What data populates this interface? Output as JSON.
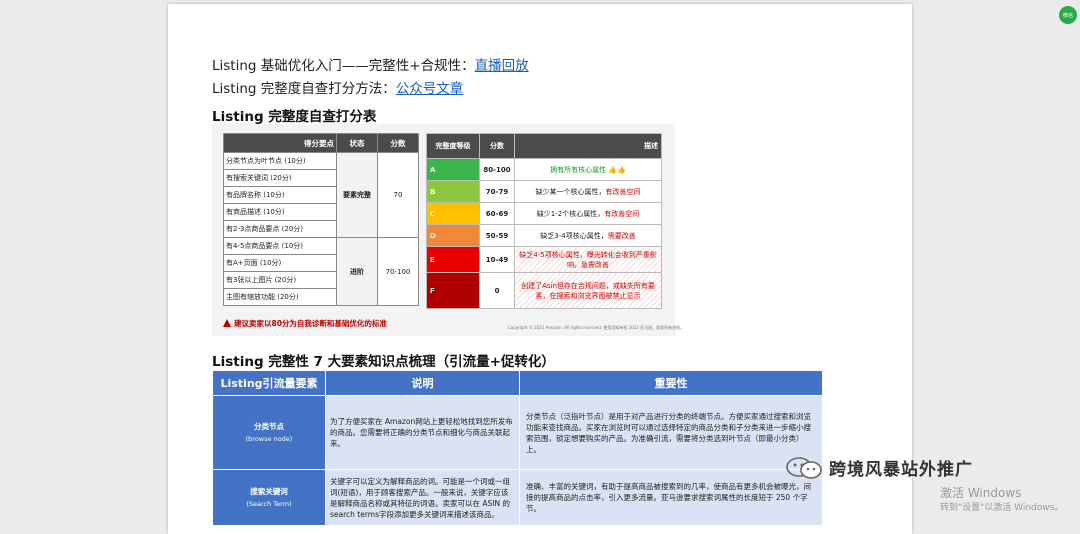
{
  "intro": {
    "line1_prefix": "Listing 基础优化入门——完整性+合规性：",
    "line1_link": "直播回放",
    "line2_prefix": "Listing 完整度自查打分方法：",
    "line2_link": "公众号文章"
  },
  "section1_title": "Listing 完整度自查打分表",
  "score_table": {
    "headers": [
      "得分要点",
      "状态",
      "分数"
    ],
    "groups": [
      {
        "state": "要素完整",
        "points": "70",
        "items": [
          "分类节点为叶节点 (10分)",
          "有搜索关键词 (20分)",
          "有品牌名称 (10分)",
          "有商品描述 (10分)",
          "有2-3点商品要点 (20分)"
        ]
      },
      {
        "state": "进阶",
        "points": "70-100",
        "items": [
          "有4-5点商品要点 (10分)",
          "有A+页面 (10分)",
          "有3张以上图片 (20分)",
          "主图有缩放功能 (20分)"
        ]
      }
    ],
    "warning": "建议卖家以80分为自我诊断和基础优化的标准"
  },
  "level_table": {
    "headers": [
      "完整度等级",
      "分数",
      "描述"
    ],
    "rows": [
      {
        "level": "A",
        "score": "80-100",
        "desc_plain": "",
        "desc_red": "",
        "desc_green": "拥有所有核心属性 👍👍",
        "color": "#3ab54a"
      },
      {
        "level": "B",
        "score": "70-79",
        "desc_plain": "缺少某一个核心属性，",
        "desc_red": "有改善空间",
        "desc_green": "",
        "color": "#8dc63f"
      },
      {
        "level": "C",
        "score": "60-69",
        "desc_plain": "缺少1-2个核心属性，",
        "desc_red": "有改善空间",
        "desc_green": "",
        "color": "#ffc000"
      },
      {
        "level": "D",
        "score": "50-59",
        "desc_plain": "缺乏3-4项核心属性，",
        "desc_red": "需要改善",
        "desc_green": "",
        "color": "#f0883a"
      },
      {
        "level": "E",
        "score": "10-49",
        "desc_plain": "",
        "desc_red": "缺乏4-5项核心属性，曝光转化会收到严重影响，急需改善",
        "desc_green": "",
        "color": "#e60000"
      },
      {
        "level": "F",
        "score": "0",
        "desc_plain": "",
        "desc_red": "创建了Asin但存在合规问题，或缺失所有要素，在搜索和浏览界面被禁止显示",
        "desc_green": "",
        "color": "#b00000"
      }
    ],
    "copyright": "Copyright © 2022 Amazon. All rights reserved. 使用须知有权 2022 亚马逊。版权所有违权。"
  },
  "section2_title": "Listing 完整性 7 大要素知识点梳理（引流量+促转化）",
  "knowledge_table": {
    "headers": [
      "Listing引流量要素",
      "说明",
      "重要性"
    ],
    "rows": [
      {
        "name": "分类节点",
        "name_en": "(browse node)",
        "desc": "为了方便买家在 Amazon网站上更轻松地找到您所发布的商品。您需要将正确的分类节点和细化与商品关联起来。",
        "importance": "分类节点（泛指叶节点）是用于对产品进行分类的终端节点。方便买家通过搜索和浏览功能来查找商品。买家在浏览时可以通过选择特定的商品分类和子分类来进一步缩小搜索范围，锁定想要购买的产品。为准确引流，需要将分类选到叶节点（即最小分类）上。"
      },
      {
        "name": "搜索关键词",
        "name_en": "(Search Term)",
        "desc": "关键字可以定义为解释商品的词。可能是一个词或一组词(短语)，用于顾客搜索产品。一般来说，关键字应该是解释商品名称或其特征的词语。卖家可以在 ASIN 的search terms字段添加更多关键词来描述该商品。",
        "importance": "准确、丰富的关键词，有助于提高商品被搜索到的几率，使商品有更多机会被曝光，间接的提高商品的点击率，引入更多流量。亚马逊要求搜索词属性的长度短于 250 个字节。"
      }
    ]
  },
  "watermark": "跨境风暴站外推广",
  "activation": {
    "line1": "激活 Windows",
    "line2": "转到\"设置\"以激活 Windows。"
  },
  "badge_text": "微信"
}
